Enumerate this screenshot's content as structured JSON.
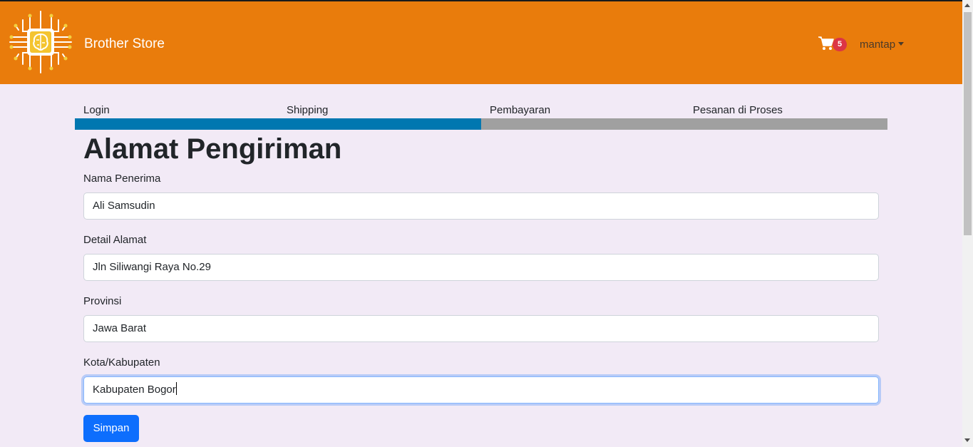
{
  "navbar": {
    "brand": "Brother Store",
    "cart_count": "5",
    "user_name": "mantap",
    "icons": {
      "logo": "circuit-brain-icon",
      "cart": "shopping-cart-icon",
      "dropdown": "caret-down-icon"
    }
  },
  "steps": {
    "items": [
      {
        "label": "Login"
      },
      {
        "label": "Shipping"
      },
      {
        "label": "Pembayaran"
      },
      {
        "label": "Pesanan di Proses"
      }
    ],
    "progress_percent": 50,
    "colors": {
      "done": "#0077b0",
      "pending": "#a0a0a0"
    }
  },
  "form": {
    "title": "Alamat Pengiriman",
    "fields": [
      {
        "label": "Nama Penerima",
        "value": "Ali Samsudin"
      },
      {
        "label": "Detail Alamat",
        "value": "Jln Siliwangi Raya No.29"
      },
      {
        "label": "Provinsi",
        "value": "Jawa Barat"
      },
      {
        "label": "Kota/Kabupaten",
        "value": "Kabupaten Bogor"
      }
    ],
    "submit_label": "Simpan"
  },
  "colors": {
    "navbar": "#e97c0c",
    "background": "#f2eaf6",
    "primary": "#0d6efd",
    "badge": "#dc3545"
  }
}
